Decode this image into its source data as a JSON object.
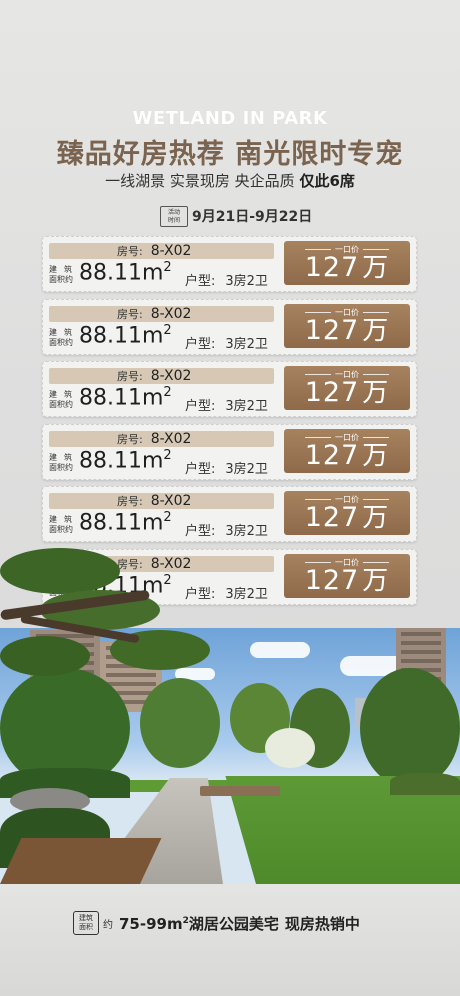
{
  "header": {
    "eyebrow": "WETLAND IN PARK",
    "headline": "臻品好房热荐 南光限时专宠",
    "subline_main": "一线湖景 实景现房 央企品质 ",
    "subline_bold": "仅此6席",
    "date_tag_line1": "活动",
    "date_tag_line2": "时间",
    "date_range": "9月21日-9月22日"
  },
  "listings": [
    {
      "room_label": "房号:",
      "room": "8-X02",
      "area_label_1": "建筑",
      "area_label_2": "面积约",
      "area": "88.11m",
      "area_unit_sup": "2",
      "type_label": "户型:",
      "type": "3房2卫",
      "price_label": "一口价",
      "price": "127",
      "price_unit": "万"
    },
    {
      "room_label": "房号:",
      "room": "8-X02",
      "area_label_1": "建筑",
      "area_label_2": "面积约",
      "area": "88.11m",
      "area_unit_sup": "2",
      "type_label": "户型:",
      "type": "3房2卫",
      "price_label": "一口价",
      "price": "127",
      "price_unit": "万"
    },
    {
      "room_label": "房号:",
      "room": "8-X02",
      "area_label_1": "建筑",
      "area_label_2": "面积约",
      "area": "88.11m",
      "area_unit_sup": "2",
      "type_label": "户型:",
      "type": "3房2卫",
      "price_label": "一口价",
      "price": "127",
      "price_unit": "万"
    },
    {
      "room_label": "房号:",
      "room": "8-X02",
      "area_label_1": "建筑",
      "area_label_2": "面积约",
      "area": "88.11m",
      "area_unit_sup": "2",
      "type_label": "户型:",
      "type": "3房2卫",
      "price_label": "一口价",
      "price": "127",
      "price_unit": "万"
    },
    {
      "room_label": "房号:",
      "room": "8-X02",
      "area_label_1": "建筑",
      "area_label_2": "面积约",
      "area": "88.11m",
      "area_unit_sup": "2",
      "type_label": "户型:",
      "type": "3房2卫",
      "price_label": "一口价",
      "price": "127",
      "price_unit": "万"
    },
    {
      "room_label": "房号:",
      "room": "8-X02",
      "area_label_1": "建筑",
      "area_label_2": "面积约",
      "area": "88.11m",
      "area_unit_sup": "2",
      "type_label": "户型:",
      "type": "3房2卫",
      "price_label": "一口价",
      "price": "127",
      "price_unit": "万"
    }
  ],
  "footer": {
    "tag_line1": "建筑",
    "tag_line2": "面积",
    "tag_suffix": "约",
    "area_range": "75-99m",
    "area_sup": "2",
    "text_mid": "湖居公园美宅",
    "text_hl": "现房热销中"
  },
  "colors": {
    "headline": "#7a634f",
    "room_bar": "#d6c8b4",
    "price_badge": "#957154",
    "card_bg": "#f2f2f0",
    "page_bg": "#dcdcdc"
  }
}
